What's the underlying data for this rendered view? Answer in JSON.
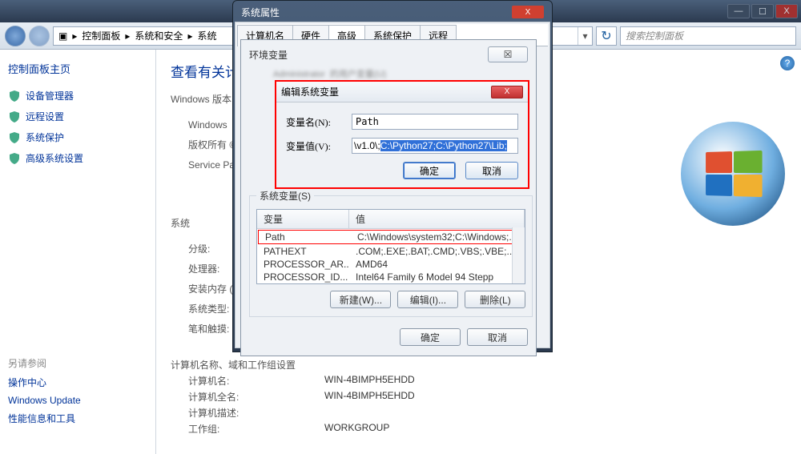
{
  "window": {
    "minimize": "—",
    "maximize": "☐",
    "close": "X"
  },
  "breadcrumb": {
    "segments": [
      "控制面板",
      "系统和安全",
      "系统"
    ],
    "sep": "▸"
  },
  "search": {
    "placeholder": "搜索控制面板"
  },
  "sidebar": {
    "home": "控制面板主页",
    "items": [
      "设备管理器",
      "远程设置",
      "系统保护",
      "高级系统设置"
    ],
    "see_also": "另请参阅",
    "links": [
      "操作中心",
      "Windows Update",
      "性能信息和工具"
    ]
  },
  "content": {
    "heading": "查看有关计",
    "edition_label": "Windows 版本",
    "edition_rows": [
      "Windows",
      "版权所有 ©",
      "Service Pa"
    ],
    "sys_label": "系统",
    "sys_rows": [
      "分级:",
      "处理器:",
      "安装内存 (",
      "系统类型:",
      "笔和触摸:"
    ],
    "cnd_label": "计算机名称、域和工作组设置",
    "cnd": [
      {
        "k": "计算机名:",
        "v": "WIN-4BIMPH5EHDD"
      },
      {
        "k": "计算机全名:",
        "v": "WIN-4BIMPH5EHDD"
      },
      {
        "k": "计算机描述:",
        "v": ""
      },
      {
        "k": "工作组:",
        "v": "WORKGROUP"
      }
    ]
  },
  "sysprop": {
    "title": "系统属性",
    "tabs": [
      "计算机名",
      "硬件",
      "高级",
      "系统保护",
      "远程"
    ],
    "active_tab": 2
  },
  "env": {
    "title": "环境变量",
    "icon_btn": "☒",
    "sysvars_label": "系统变量(S)",
    "col_var": "变量",
    "col_val": "值",
    "rows": [
      {
        "n": "Path",
        "v": "C:\\Windows\\system32;C:\\Windows;..."
      },
      {
        "n": "PATHEXT",
        "v": ".COM;.EXE;.BAT;.CMD;.VBS;.VBE;..."
      },
      {
        "n": "PROCESSOR_AR...",
        "v": "AMD64"
      },
      {
        "n": "PROCESSOR_ID...",
        "v": "Intel64 Family 6 Model 94 Stepp"
      }
    ],
    "btn_new": "新建(W)...",
    "btn_edit": "编辑(I)...",
    "btn_del": "删除(L)",
    "ok": "确定",
    "cancel": "取消"
  },
  "edit": {
    "title": "编辑系统变量",
    "name_label": "变量名(N):",
    "name_value": "Path",
    "value_label": "变量值(V):",
    "value_prefix": "\\v1.0\\;",
    "value_selected": "C:\\Python27;C:\\Python27\\Lib;",
    "ok": "确定",
    "cancel": "取消"
  }
}
